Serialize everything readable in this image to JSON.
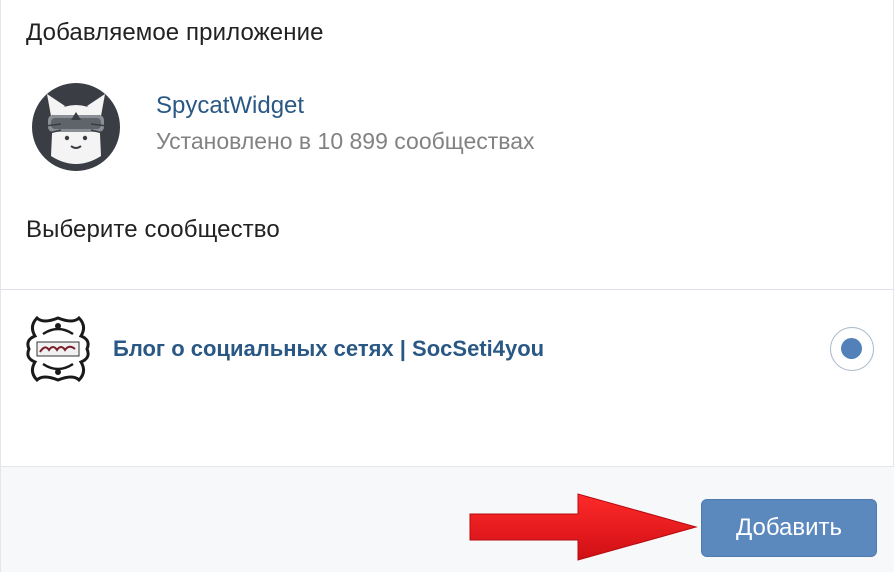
{
  "app_section": {
    "heading": "Добавляемое приложение",
    "app_name": "SpycatWidget",
    "installed_text": "Установлено в 10 899 сообществах",
    "avatar_icon": "spycat-avatar-icon"
  },
  "community_section": {
    "heading": "Выберите сообщество",
    "communities": [
      {
        "name": "Блог о социальных сетях | SocSeti4you",
        "logo_icon": "socseti4you-logo-icon",
        "selected": true
      }
    ]
  },
  "footer": {
    "add_label": "Добавить",
    "arrow_icon": "red-arrow-icon"
  },
  "colors": {
    "link": "#2a5885",
    "button": "#5b88bd",
    "radio_selected": "#5181b8",
    "arrow": "#e8161b"
  }
}
